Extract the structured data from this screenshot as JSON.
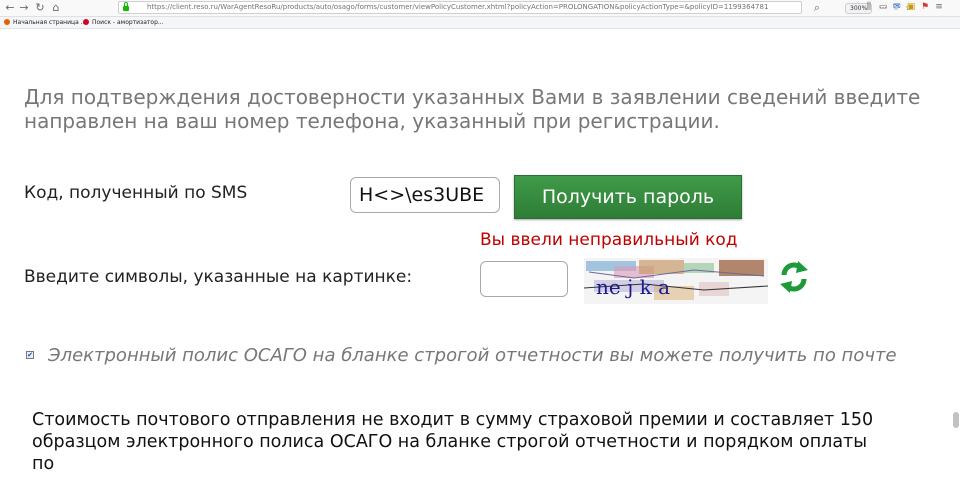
{
  "browser": {
    "url": "https://client.reso.ru/WarAgentResoRu/products/auto/osago/forms/customer/viewPolicyCustomer.xhtml?policyAction=PROLONGATION&policyActionType=&policyID=1199364781",
    "zoom": "300%",
    "bookmarks": [
      {
        "label": "Начальная страница ...",
        "color": "#e66000"
      },
      {
        "label": "Поиск - амортизатор...",
        "color": "#d70022"
      }
    ]
  },
  "page": {
    "info_line1": "Для подтверждения достоверности указанных Вами в заявлении сведений введите",
    "info_line2": "направлен на ваш номер телефона, указанный при регистрации.",
    "sms_label": "Код, полученный по SMS",
    "sms_value": "H<>\\es3UBE",
    "get_password_label": "Получить пароль",
    "error_text": "Вы ввели неправильный код",
    "captcha_label": "Введите символы, указанные на картинке:",
    "captcha_value": "",
    "captcha_text": "ne j k a",
    "epolicy_checked": true,
    "epolicy_text": "Электронный полис ОСАГО на бланке строгой отчетности вы можете получить по почте",
    "cost_line1": "Стоимость почтового отправления не входит в сумму страховой премии и составляет 150",
    "cost_line2": "образцом электронного полиса ОСАГО на бланке строгой отчетности и порядком оплаты",
    "cost_line3": "по"
  },
  "colors": {
    "button_green": "#2e7d36",
    "error_red": "#c00000",
    "info_gray": "#777777",
    "refresh_green": "#1f9a3a"
  }
}
